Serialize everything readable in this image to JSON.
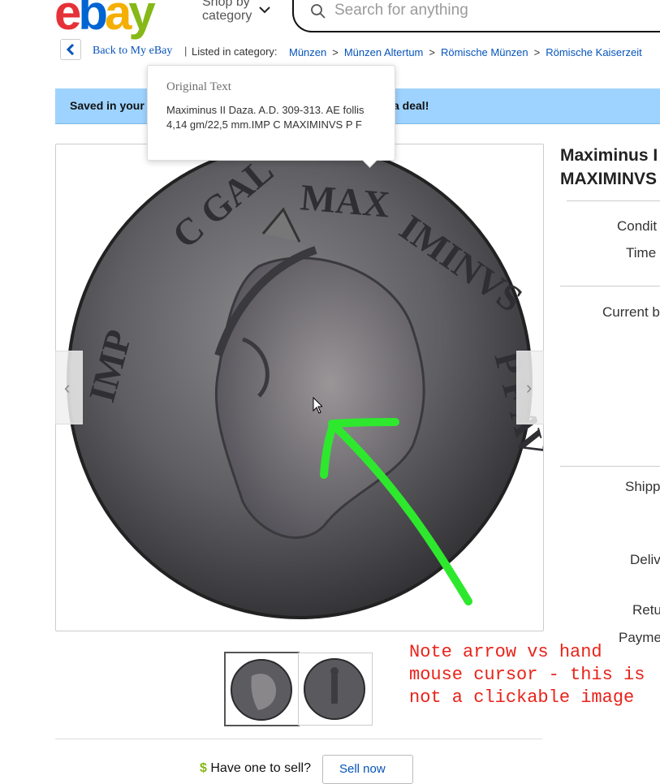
{
  "header": {
    "logo": {
      "e": "e",
      "b": "b",
      "a": "a",
      "y": "y"
    },
    "shop_by_line1": "Shop by",
    "shop_by_line2": "category",
    "search_placeholder": "Search for anything"
  },
  "breadcrumb": {
    "back_label": "Back to My eBay",
    "separator": "|",
    "listed_label": "Listed in category:",
    "items": [
      "Münzen",
      "Münzen Altertum",
      "Römische Münzen",
      "Römische Kaiserzeit"
    ],
    "gt": ">"
  },
  "banner": {
    "left_text": "Saved in your",
    "right_text": "a deal!",
    "color": "#9ed3ff"
  },
  "tooltip": {
    "title": "Original Text",
    "body": "Maximinus II Daza. A.D. 309-313. AE follis 4,14 gm/22,5 mm.IMP C MAXIMINVS P F"
  },
  "gallery": {
    "prev_glyph": "‹",
    "next_glyph": "›"
  },
  "annotation": {
    "text": "Note arrow vs hand\nmouse cursor - this is\nnot a clickable image",
    "color": "#e8231a",
    "arrow_color": "#2ee82e"
  },
  "sell": {
    "dollar": "$",
    "prompt": "Have one to sell?",
    "button": "Sell now"
  },
  "item": {
    "title_line1": "Maximinus I",
    "title_line2": "MAXIMINVS",
    "labels": {
      "condition": "Condit",
      "time": "Time",
      "current_bid": "Current b",
      "shipping": "Shipp",
      "delivery": "Deliv",
      "returns": "Retu",
      "payments": "Payme"
    }
  }
}
